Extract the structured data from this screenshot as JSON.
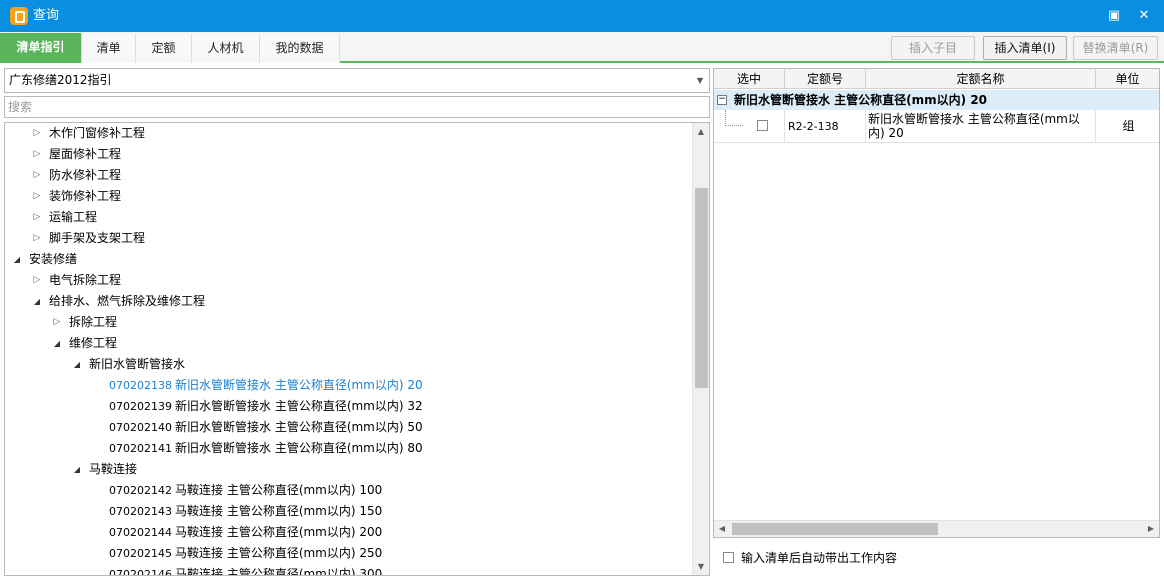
{
  "window": {
    "title": "查询",
    "controls": {
      "restore": "▣",
      "minimize": "▬",
      "close": "✕"
    }
  },
  "tabs": [
    {
      "label": "清单指引",
      "active": true
    },
    {
      "label": "清单",
      "active": false
    },
    {
      "label": "定额",
      "active": false
    },
    {
      "label": "人材机",
      "active": false
    },
    {
      "label": "我的数据",
      "active": false
    }
  ],
  "toolbar": {
    "insert_child": "插入子目",
    "insert_list": "插入清单(I)",
    "replace_list": "替换清单(R)"
  },
  "left": {
    "guide_select": "广东修缮2012指引",
    "search_placeholder": "搜索",
    "tree": [
      {
        "label": "木作门窗修补工程",
        "level": 1,
        "state": "collapsed"
      },
      {
        "label": "屋面修补工程",
        "level": 1,
        "state": "collapsed"
      },
      {
        "label": "防水修补工程",
        "level": 1,
        "state": "collapsed"
      },
      {
        "label": "装饰修补工程",
        "level": 1,
        "state": "collapsed"
      },
      {
        "label": "运输工程",
        "level": 1,
        "state": "collapsed"
      },
      {
        "label": "脚手架及支架工程",
        "level": 1,
        "state": "collapsed"
      },
      {
        "label": "安装修缮",
        "level": 0,
        "state": "expanded"
      },
      {
        "label": "电气拆除工程",
        "level": 1,
        "state": "collapsed"
      },
      {
        "label": "给排水、燃气拆除及维修工程",
        "level": 1,
        "state": "expanded"
      },
      {
        "label": "拆除工程",
        "level": 2,
        "state": "collapsed"
      },
      {
        "label": "维修工程",
        "level": 2,
        "state": "expanded"
      },
      {
        "label": "新旧水管断管接水",
        "level": 3,
        "state": "expanded"
      },
      {
        "code": "070202138",
        "name": "新旧水管断管接水 主管公称直径(mm以内) 20",
        "level": 4,
        "selected": true
      },
      {
        "code": "070202139",
        "name": "新旧水管断管接水 主管公称直径(mm以内) 32",
        "level": 4
      },
      {
        "code": "070202140",
        "name": "新旧水管断管接水 主管公称直径(mm以内) 50",
        "level": 4
      },
      {
        "code": "070202141",
        "name": "新旧水管断管接水 主管公称直径(mm以内) 80",
        "level": 4
      },
      {
        "label": "马鞍连接",
        "level": 3,
        "state": "expanded"
      },
      {
        "code": "070202142",
        "name": "马鞍连接 主管公称直径(mm以内) 100",
        "level": 4
      },
      {
        "code": "070202143",
        "name": "马鞍连接 主管公称直径(mm以内) 150",
        "level": 4
      },
      {
        "code": "070202144",
        "name": "马鞍连接 主管公称直径(mm以内) 200",
        "level": 4
      },
      {
        "code": "070202145",
        "name": "马鞍连接 主管公称直径(mm以内) 250",
        "level": 4
      },
      {
        "code": "070202146",
        "name": "马鞍连接 主管公称直径(mm以内) 300",
        "level": 4
      }
    ]
  },
  "right": {
    "columns": [
      "选中",
      "定额号",
      "定额名称",
      "单位"
    ],
    "group_title": "新旧水管断管接水 主管公称直径(mm以内) 20",
    "rows": [
      {
        "checked": false,
        "code": "R2-2-138",
        "name": "新旧水管断管接水 主管公称直径(mm以内) 20",
        "unit": "组"
      }
    ],
    "auto_option": "输入清单后自动带出工作内容"
  },
  "colors": {
    "titlebar": "#0a8ee0",
    "active_tab": "#5ab55a",
    "selected_text": "#1a7fd0",
    "group_row": "#dcecf9"
  }
}
